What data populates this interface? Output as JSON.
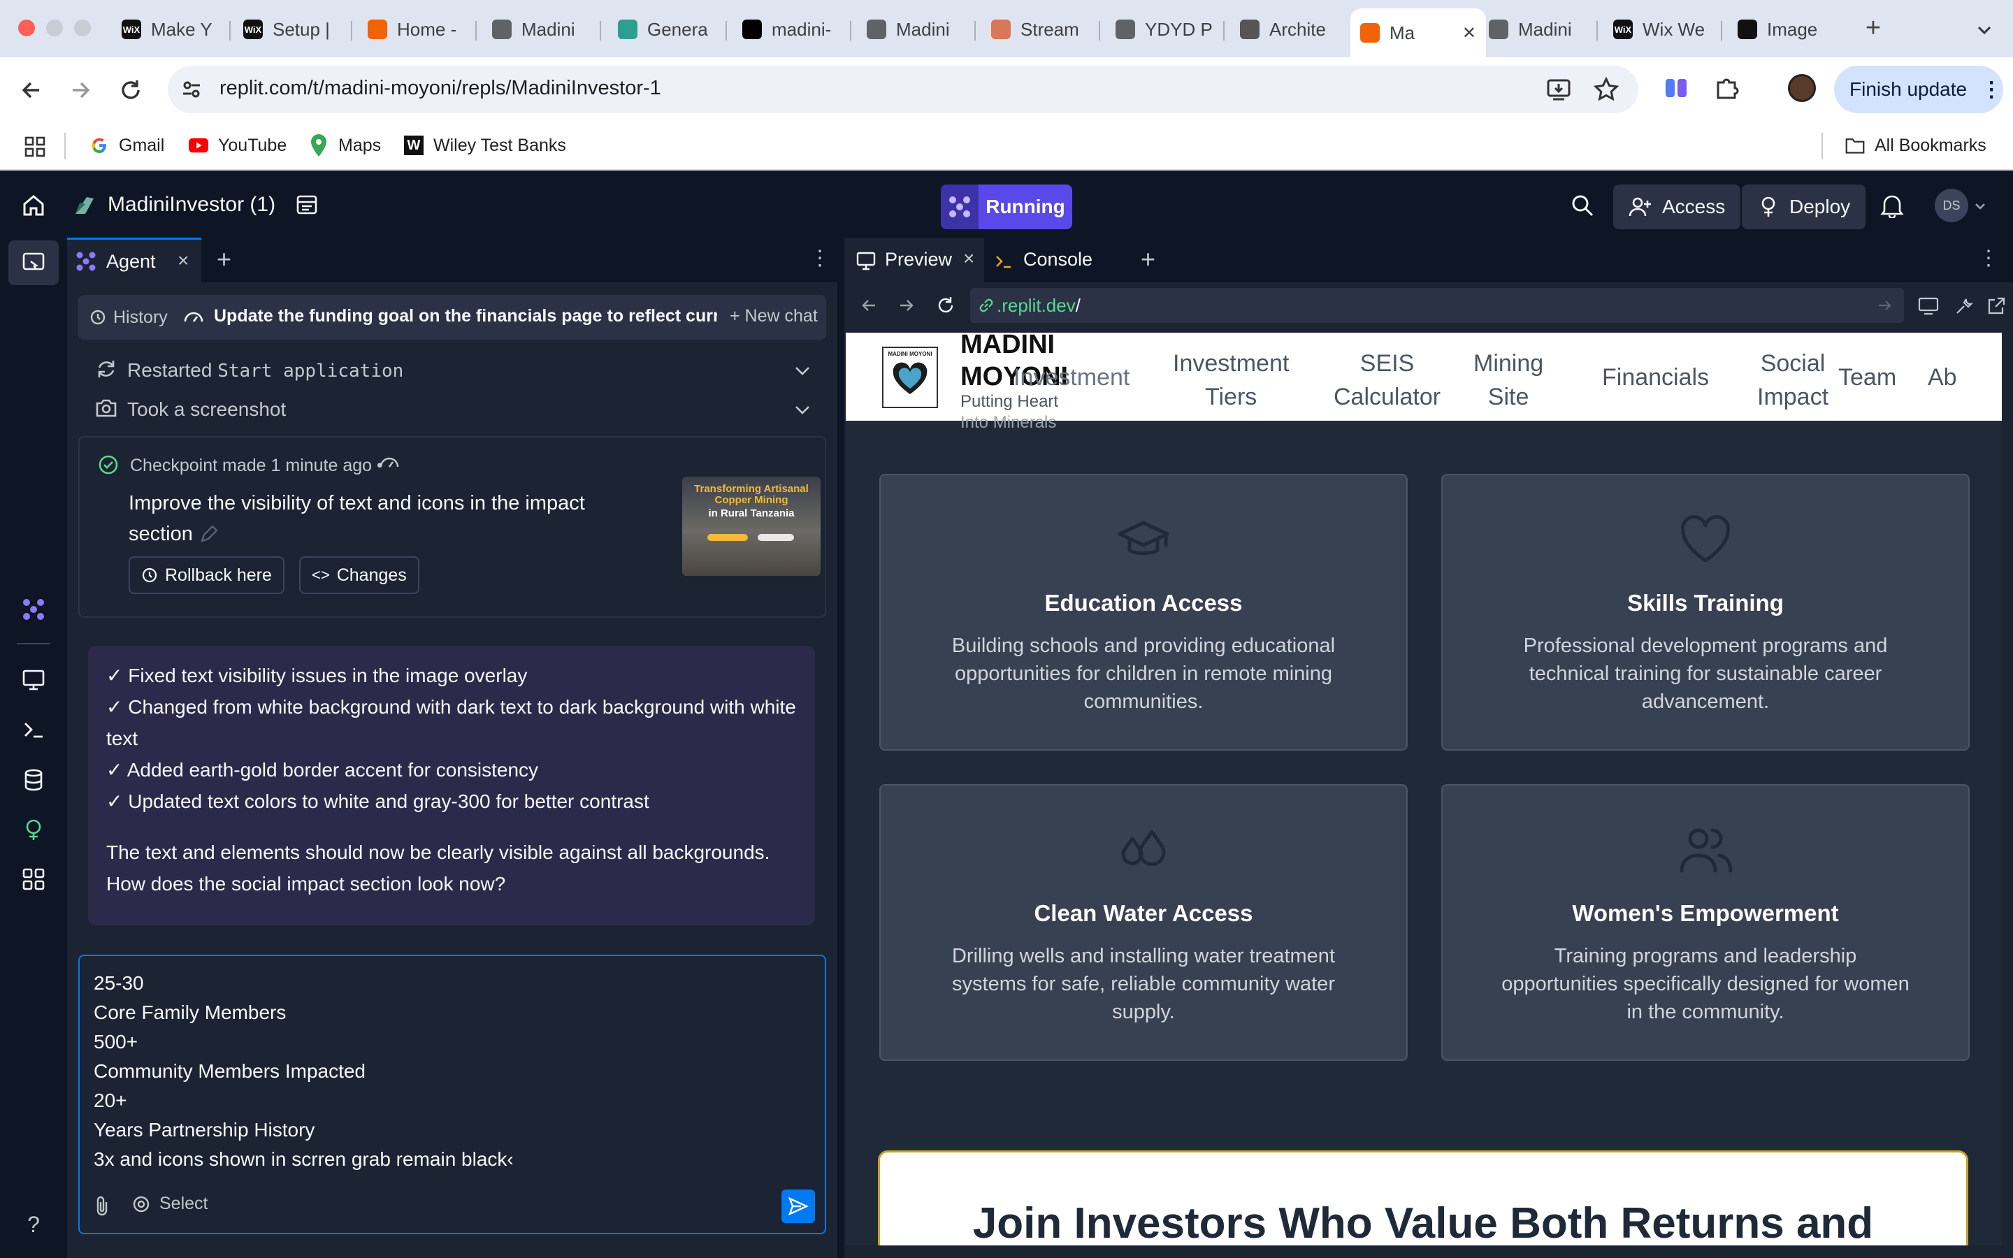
{
  "browser": {
    "tabs": [
      {
        "title": "Make Y",
        "icon": "wix-icon"
      },
      {
        "title": "Setup |",
        "icon": "wix-icon"
      },
      {
        "title": "Home -",
        "icon": "replit-icon"
      },
      {
        "title": "Madini",
        "icon": "globe-icon"
      },
      {
        "title": "Genera",
        "icon": "diamond-icon"
      },
      {
        "title": "madini-",
        "icon": "vercel-icon"
      },
      {
        "title": "Madini",
        "icon": "globe-icon"
      },
      {
        "title": "Stream",
        "icon": "claude-icon"
      },
      {
        "title": "YDYD P",
        "icon": "globe-icon"
      },
      {
        "title": "Archite",
        "icon": "logo-icon"
      },
      {
        "title": "Ma",
        "icon": "replit-icon"
      },
      {
        "title": "Madini",
        "icon": "globe-icon"
      },
      {
        "title": "Wix We",
        "icon": "wix-icon"
      },
      {
        "title": "Image",
        "icon": "openai-icon"
      }
    ],
    "wix_label": "WiX",
    "url": "replit.com/t/madini-moyoni/repls/MadiniInvestor-1",
    "finish_update": "Finish update",
    "bookmarks": [
      "Gmail",
      "YouTube",
      "Maps",
      "Wiley Test Banks"
    ],
    "all_bookmarks": "All Bookmarks"
  },
  "replit": {
    "project_name": "MadiniInvestor (1)",
    "run_status": "Running",
    "access_label": "Access",
    "deploy_label": "Deploy",
    "avatar_initials": "DS",
    "agent_tab": "Agent",
    "history_label": "History",
    "chat_title": "Update the funding goal on the financials page to reflect curre...",
    "new_chat": "New chat",
    "actions": [
      {
        "verb": "Restarted",
        "detail": "Start application"
      },
      {
        "verb": "Took a screenshot",
        "detail": ""
      }
    ],
    "checkpoint": {
      "label": "Checkpoint made",
      "time": "1 minute ago",
      "separator": "•",
      "description": "Improve the visibility of text and icons in the impact section",
      "rollback": "Rollback here",
      "changes": "Changes",
      "thumb_title": "Transforming Artisanal Copper Mining",
      "thumb_subtitle": "in Rural Tanzania"
    },
    "agent_message": {
      "lines": [
        "✓ Fixed text visibility issues in the image overlay",
        "✓ Changed from white background with dark text to dark background with white text",
        "✓ Added earth-gold border accent for consistency",
        "✓ Updated text colors to white and gray-300 for better contrast"
      ],
      "followup": "The text and elements should now be clearly visible against all backgrounds. How does the social impact section look now?"
    },
    "input_lines": [
      "25-30",
      "Core Family Members",
      "500+",
      "Community Members Impacted",
      "20+",
      "Years Partnership History",
      "3x and icons shown in scrren grab remain black‹"
    ],
    "select_label": "Select",
    "preview_tab": "Preview",
    "console_tab": "Console",
    "preview_url_host": ".replit.dev",
    "preview_url_path": "/"
  },
  "site": {
    "brand_title_1": "MADINI",
    "brand_title_2": "MOYONI",
    "tagline_1": "Putting Heart",
    "tagline_2": "Into Minerals",
    "logo_caption": "MADINI MOYONI",
    "nav": [
      {
        "l1": "Investment",
        "l2": ""
      },
      {
        "l1": "Investment",
        "l2": "Tiers"
      },
      {
        "l1": "SEIS",
        "l2": "Calculator"
      },
      {
        "l1": "Mining",
        "l2": "Site"
      },
      {
        "l1": "Financials",
        "l2": ""
      },
      {
        "l1": "Social",
        "l2": "Impact"
      },
      {
        "l1": "Team",
        "l2": ""
      },
      {
        "l1": "Ab",
        "l2": ""
      }
    ],
    "cards": [
      {
        "title": "Education Access",
        "desc": "Building schools and providing educational opportunities for children in remote mining communities.",
        "icon": "graduation-cap-icon"
      },
      {
        "title": "Skills Training",
        "desc": "Professional development programs and technical training for sustainable career advancement.",
        "icon": "heart-icon"
      },
      {
        "title": "Clean Water Access",
        "desc": "Drilling wells and installing water treatment systems for safe, reliable community water supply.",
        "icon": "water-drops-icon"
      },
      {
        "title": "Women's Empowerment",
        "desc": "Training programs and leadership opportunities specifically designed for women in the community.",
        "icon": "users-icon"
      }
    ],
    "cta_heading": "Join Investors Who Value Both Returns and"
  },
  "colors": {
    "chrome_bg": "#dfe4f1",
    "replit_bg": "#0e1525",
    "panel_bg": "#1c2333",
    "running": "#5a48e8",
    "message_bg": "#2c2a4a",
    "card_bg": "#374151",
    "preview_bg": "#1f2937"
  }
}
